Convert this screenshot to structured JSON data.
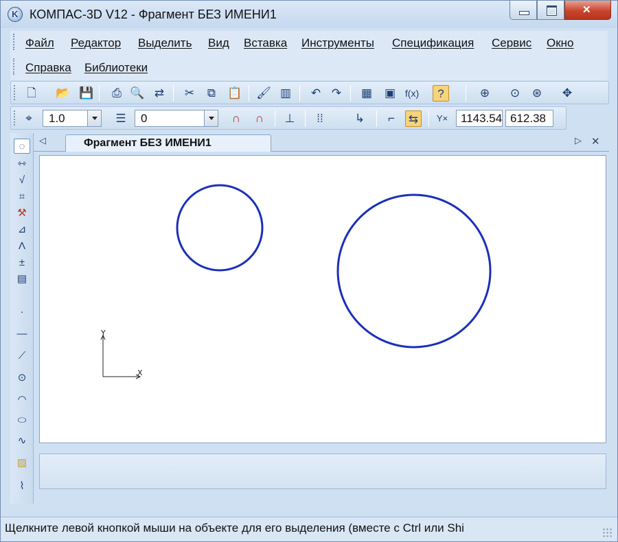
{
  "window": {
    "title": "КОМПАС-3D V12 - Фрагмент БЕЗ ИМЕНИ1",
    "icon": "kompas-app-icon",
    "controls": [
      "minimize-icon",
      "maximize-icon",
      "close-icon"
    ]
  },
  "menu": {
    "items": [
      "Файл",
      "Редактор",
      "Выделить",
      "Вид",
      "Вставка",
      "Инструменты",
      "Спецификация",
      "Сервис",
      "Окно",
      "Справка",
      "Библиотеки"
    ]
  },
  "toolbar_standard": {
    "icons": [
      "new-document-icon",
      "open-icon",
      "save-icon",
      "print-icon",
      "preview-icon",
      "manager-icon",
      "cut-icon",
      "copy-icon",
      "paste-icon",
      "properties-brush-icon",
      "library-icon",
      "undo-icon",
      "redo-icon",
      "calculator-icon",
      "variables-icon",
      "function-icon",
      "help-pointer-icon",
      "zoom-window-icon",
      "zoom-all-icon",
      "zoom-in-icon",
      "pan-icon"
    ]
  },
  "toolbar_current_state": {
    "step": "1.0",
    "layer": "0",
    "coord_x": "1143.54",
    "coord_y": "612.38",
    "icons": [
      "cursor-step-icon",
      "layers-icon",
      "snap-global-icon",
      "snap-local-icon",
      "ortho-icon",
      "grid-icon",
      "local-cs-icon",
      "ortho-mode-icon",
      "parametric-mode-icon",
      "cursor-coordinates-icon"
    ]
  },
  "left_toolbar": {
    "icons": [
      "geometry-icon",
      "dimensions-icon",
      "designations-icon",
      "edit-icon",
      "parametrize-icon",
      "measure-icon",
      "select-icon",
      "spec-icon",
      "document-icon",
      "point-icon",
      "auxiliary-line-icon",
      "segment-icon",
      "circle-icon",
      "arc-icon",
      "ellipse-icon",
      "spline-icon",
      "hatch-icon",
      "contour-icon"
    ]
  },
  "document_tab": {
    "label": "Фрагмент БЕЗ ИМЕНИ1"
  },
  "drawing": {
    "axis_y_label": "Y",
    "axis_x_label": "X",
    "line_color": "#1a2fb8",
    "circles": [
      {
        "name": "small-circle"
      },
      {
        "name": "large-circle"
      }
    ]
  },
  "status": {
    "text": "Щелкните левой кнопкой мыши на объекте для его выделения (вместе с Ctrl или Shi"
  }
}
